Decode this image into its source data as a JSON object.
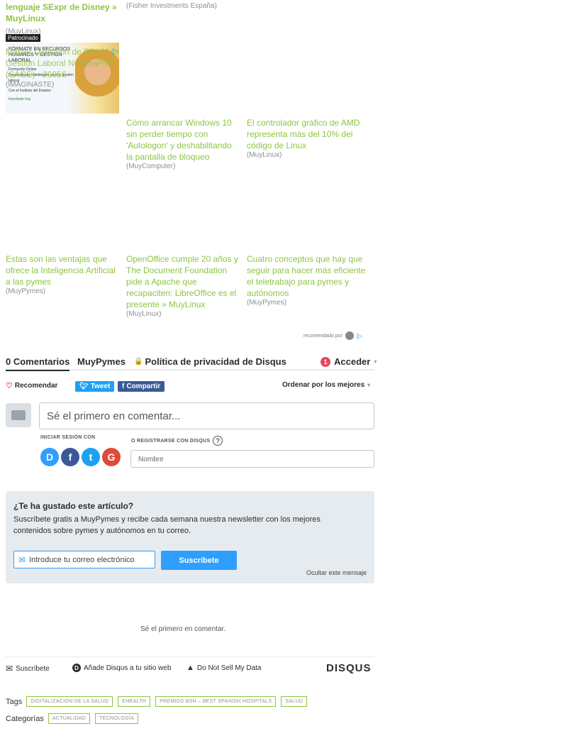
{
  "top_items": [
    {
      "title": "lenguaje SExpr de Disney » MuyLinux",
      "source": "(MuyLinux)"
    },
    {
      "title": "",
      "source": "(Fisher Investments España)"
    }
  ],
  "sponsored": {
    "badge": "Patrocinado",
    "title_overlay": "Máster Dirección de RRHH y Gestión Laboral NominaPlus (SAGE) - 2605€",
    "source": "(IMAGINASTE)",
    "ad_lines": [
      "FÓRMATE EN RECURSOS",
      "HUMANOS Y GESTIÓN",
      "LABORAL",
      "Formación Online",
      "Desarrolla tus habilidades para la gestión",
      "laboral",
      "Con el Instituto del Empleo",
      "Inscríbete hoy"
    ]
  },
  "recommendations": [
    {
      "title": "Cómo arrancar Windows 10 sin perder tiempo con 'Autologon' y deshabilitando la pantalla de bloqueo",
      "source": "(MuyComputer)"
    },
    {
      "title": "El controlador gráfico de AMD representa más del 10% del código de Linux",
      "source": "(MuyLinux)"
    },
    {
      "title": "Estas son las ventajas que ofrece la Inteligencia Artificial a las pymes",
      "source": "(MuyPymes)"
    },
    {
      "title": "OpenOffice cumple 20 años y The Document Foundation pide a Apache que recapaciten: LibreOffice es el presente » MuyLinux",
      "source": "(MuyLinux)"
    },
    {
      "title": "Cuatro conceptos que hay que seguir para hacer más eficiente el teletrabajo para pymes y autónomos",
      "source": "(MuyPymes)"
    }
  ],
  "recommended_by": "recomendado por",
  "disqus": {
    "tabs": {
      "comments": "0 Comentarios",
      "site": "MuyPymes",
      "privacy": "Política de privacidad de Disqus"
    },
    "login": {
      "badge": "1",
      "label": "Acceder"
    },
    "actions": {
      "recommend": "Recomendar",
      "tweet": "Tweet",
      "share": "Compartir",
      "sort": "Ordenar por los mejores"
    },
    "comment_placeholder": "Sé el primero en comentar...",
    "login_with": "INICIAR SESIÓN CON",
    "register_with": "O REGISTRARSE CON DISQUS",
    "name_placeholder": "Nombre",
    "empty_message": "Sé el primero en comentar.",
    "footer": {
      "subscribe": "Suscríbete",
      "add": "Añade Disqus a tu sitio web",
      "dnsmd": "Do Not Sell My Data",
      "brand": "DISQUS"
    }
  },
  "newsletter": {
    "heading": "¿Te ha gustado este artículo?",
    "text": "Suscríbete gratis a MuyPymes y recibe cada semana nuestra newsletter con los mejores contenidos sobre pymes y autónomos en tu correo.",
    "email_placeholder": "Introduce tu correo electrónico",
    "button": "Suscríbete",
    "hide": "Ocultar este mensaje"
  },
  "tags": {
    "label": "Tags",
    "items": [
      "DIGITALIZACIÓN DE LA SALUD",
      "EHEALTH",
      "PREMIOS BSH – BEST SPANISH HOSPITALS",
      "SALUD"
    ]
  },
  "categories": {
    "label": "Categorías",
    "items": [
      "ACTUALIDAD",
      "TECNOLOGÍA"
    ]
  },
  "colors": {
    "accent": "#8cc63f",
    "disqus_blue": "#2e9fff",
    "twitter": "#1da1f2",
    "facebook": "#3b5998",
    "google": "#dd4b39"
  }
}
